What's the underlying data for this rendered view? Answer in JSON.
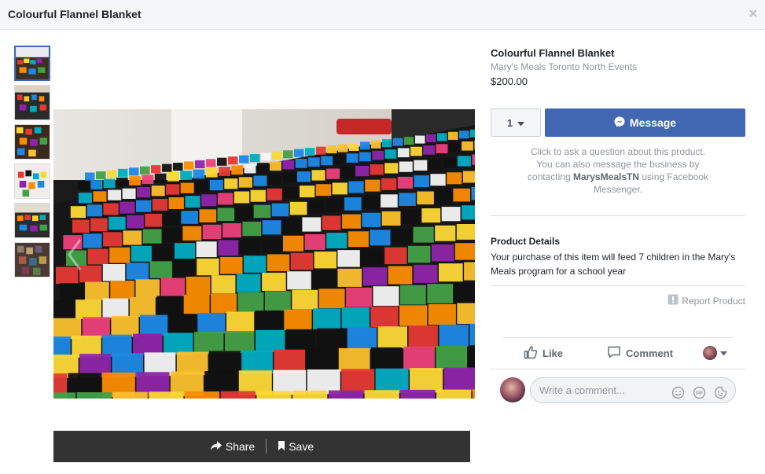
{
  "header": {
    "title": "Colourful Flannel Blanket",
    "close_icon": "close-icon"
  },
  "gallery": {
    "thumbnail_count": 6,
    "active_index": 0
  },
  "actions": {
    "share_label": "Share",
    "save_label": "Save"
  },
  "product": {
    "title": "Colourful Flannel Blanket",
    "seller": "Mary's Meals Toronto North Events",
    "price": "$200.00",
    "quantity": "1",
    "message_label": "Message",
    "help_text_1": "Click to ask a question about this product. You can also message the business by contacting ",
    "help_business": "MarysMealsTN",
    "help_text_2": " using Facebook Messenger.",
    "details_title": "Product Details",
    "details_text": "Your purchase of this item will feed 7 children in the Mary's Meals program for a school year",
    "report_label": "Report Product"
  },
  "social": {
    "like_label": "Like",
    "comment_label": "Comment",
    "comment_placeholder": "Write a comment..."
  },
  "colors": {
    "accent": "#4267b2",
    "bar": "#333333"
  }
}
